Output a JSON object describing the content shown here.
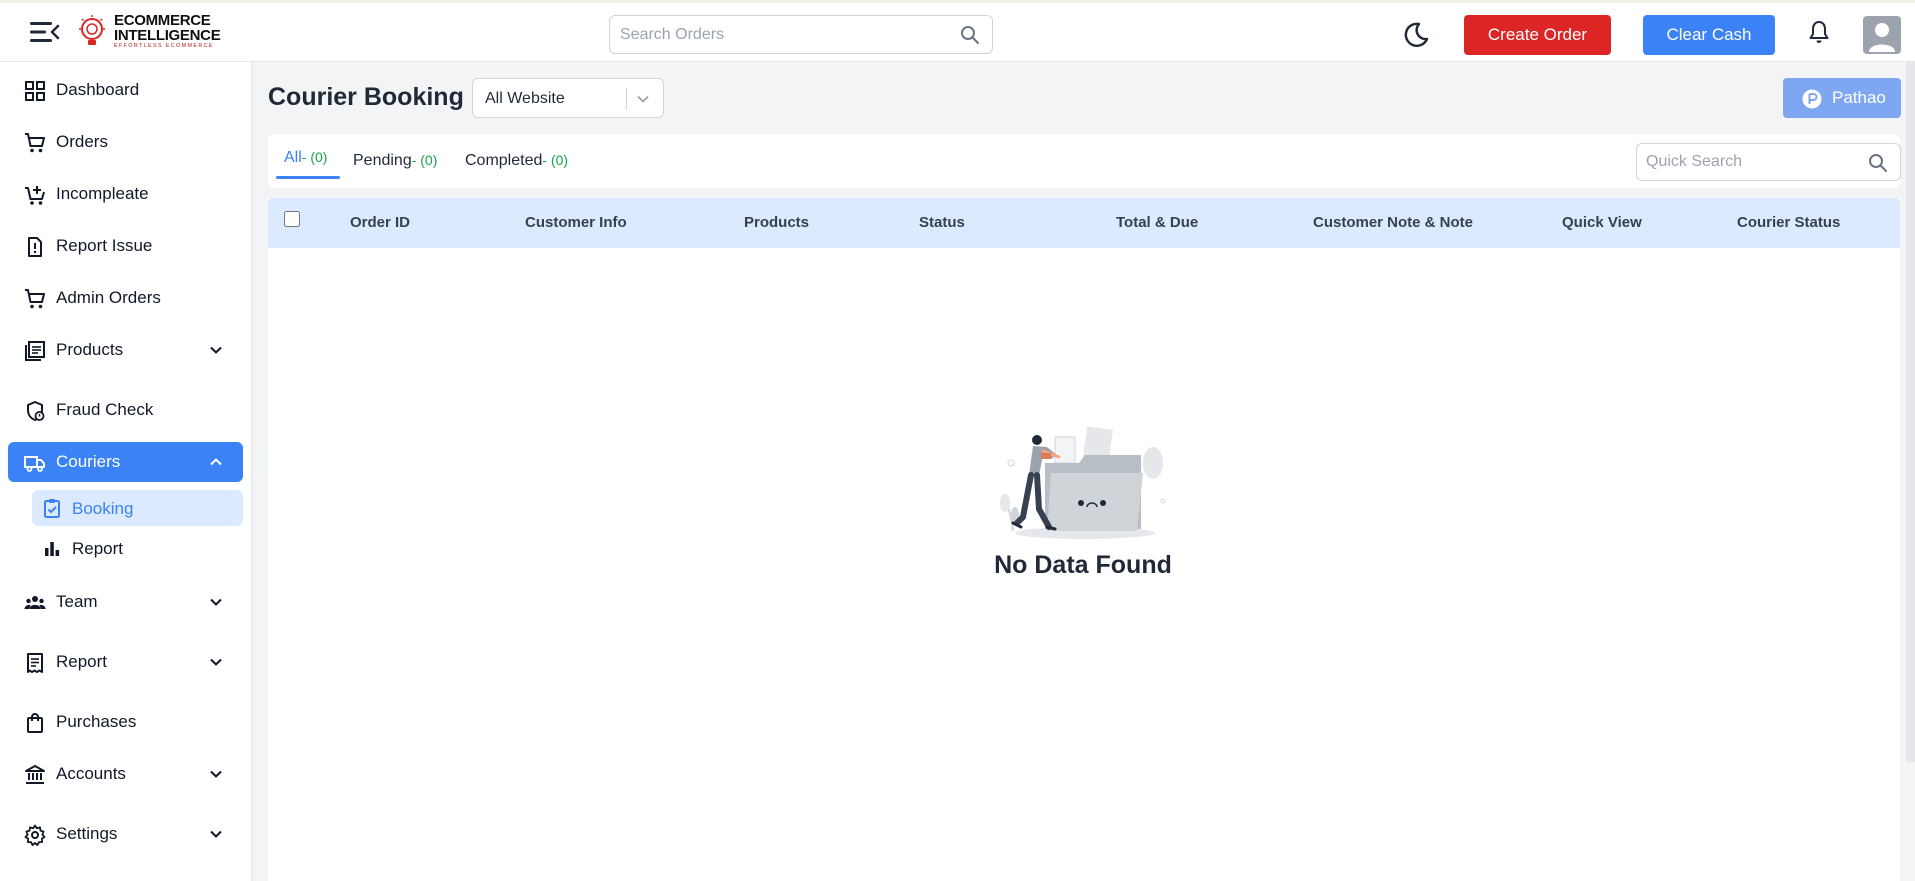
{
  "header": {
    "logo": {
      "line1": "ECOMMERCE",
      "line2": "INTELLIGENCE",
      "tagline": "EFFORTLESS ECOMMERCE"
    },
    "search_placeholder": "Search Orders",
    "create_order_label": "Create Order",
    "clear_cash_label": "Clear Cash"
  },
  "sidebar": {
    "items": [
      {
        "label": "Dashboard"
      },
      {
        "label": "Orders"
      },
      {
        "label": "Incompleate"
      },
      {
        "label": "Report Issue"
      },
      {
        "label": "Admin Orders"
      },
      {
        "label": "Products"
      },
      {
        "label": "Fraud Check"
      },
      {
        "label": "Couriers"
      },
      {
        "label": "Team"
      },
      {
        "label": "Report"
      },
      {
        "label": "Purchases"
      },
      {
        "label": "Accounts"
      },
      {
        "label": "Settings"
      }
    ],
    "sub_items": [
      {
        "label": "Booking"
      },
      {
        "label": "Report"
      }
    ]
  },
  "page": {
    "title": "Courier Booking",
    "website_select": "All Website",
    "pathao_label": "Pathao"
  },
  "tabs": [
    {
      "label": "All",
      "count": "- (0)"
    },
    {
      "label": "Pending",
      "count": "- (0)"
    },
    {
      "label": "Completed",
      "count": "- (0)"
    }
  ],
  "quick_search_placeholder": "Quick Search",
  "table": {
    "columns": [
      "Order ID",
      "Customer Info",
      "Products",
      "Status",
      "Total & Due",
      "Customer Note & Note",
      "Quick View",
      "Courier Status"
    ]
  },
  "empty_state": {
    "message": "No Data Found"
  },
  "colors": {
    "primary": "#3b82f6",
    "danger": "#dc2626",
    "count_green": "#16a34a"
  }
}
